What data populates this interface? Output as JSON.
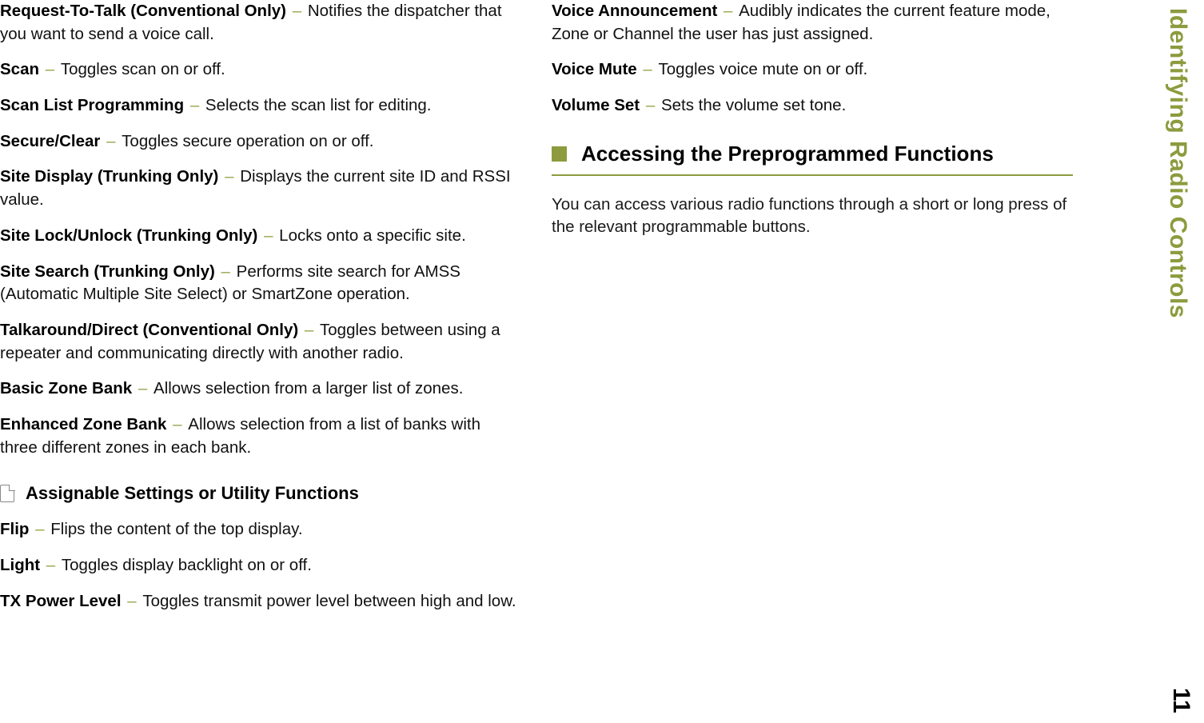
{
  "sideLabel": "Identifying Radio Controls",
  "pageNumber": "11",
  "leftColumn": {
    "entries": [
      {
        "term": "Request-To-Talk (Conventional Only)",
        "desc": "Notifies the dispatcher that you want to send a voice call."
      },
      {
        "term": "Scan",
        "desc": "Toggles scan on or off."
      },
      {
        "term": "Scan List Programming",
        "desc": "Selects the scan list for editing."
      },
      {
        "term": "Secure/Clear",
        "desc": "Toggles secure operation on or off."
      },
      {
        "term": "Site Display (Trunking Only)",
        "desc": "Displays the current site ID and RSSI value."
      },
      {
        "term": "Site Lock/Unlock (Trunking Only)",
        "desc": "Locks onto a specific site."
      },
      {
        "term": "Site Search (Trunking Only)",
        "desc": "Performs site search for AMSS (Automatic Multiple Site Select) or SmartZone operation."
      },
      {
        "term": "Talkaround/Direct (Conventional Only)",
        "desc": "Toggles between using a repeater and communicating directly with another radio."
      },
      {
        "term": "Basic Zone Bank",
        "desc": "Allows selection from a larger list of zones."
      },
      {
        "term": "Enhanced Zone Bank",
        "desc": "Allows selection from a list of banks with three different zones in each bank."
      }
    ],
    "subheading": "Assignable Settings or Utility Functions",
    "subEntries": [
      {
        "term": "Flip",
        "desc": "Flips the content of the top display."
      },
      {
        "term": "Light",
        "desc": "Toggles display backlight on or off."
      },
      {
        "term": "TX Power Level",
        "desc": "Toggles transmit power level between high and low."
      }
    ]
  },
  "rightColumn": {
    "entries": [
      {
        "term": "Voice Announcement",
        "desc": "Audibly indicates the current feature mode, Zone or Channel the user has just assigned."
      },
      {
        "term": "Voice Mute",
        "desc": "Toggles voice mute on or off."
      },
      {
        "term": "Volume Set",
        "desc": "Sets the volume set tone."
      }
    ],
    "sectionTitle": "Accessing the Preprogrammed Functions",
    "sectionBody": "You can access various radio functions through a short or long press of the relevant programmable buttons."
  }
}
